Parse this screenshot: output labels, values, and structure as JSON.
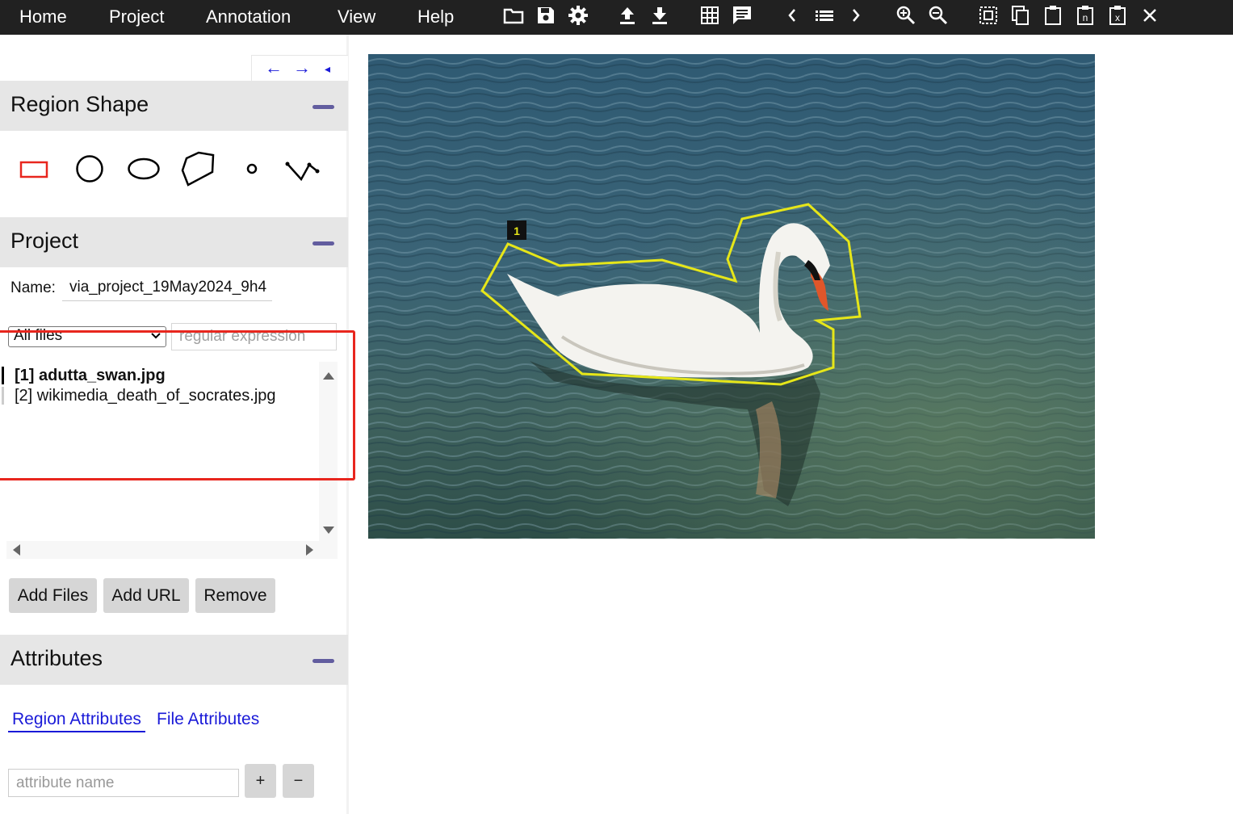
{
  "menu": [
    "Home",
    "Project",
    "Annotation",
    "View",
    "Help"
  ],
  "toolbar_icons": [
    "folder-open-icon",
    "save-icon",
    "settings-gear-icon",
    "upload-icon",
    "download-icon",
    "grid-view-icon",
    "comment-icon",
    "prev-icon",
    "list-icon",
    "next-icon",
    "zoom-in-icon",
    "zoom-out-icon",
    "select-all-icon",
    "copy-icon",
    "paste-icon",
    "paste-n-icon",
    "paste-x-icon",
    "close-icon"
  ],
  "nav_arrows": [
    "←",
    "→",
    "◂"
  ],
  "region_shape": {
    "title": "Region Shape",
    "shapes": [
      "rectangle-icon",
      "circle-icon",
      "ellipse-icon",
      "polygon-icon",
      "point-icon",
      "polyline-icon"
    ]
  },
  "project": {
    "title": "Project",
    "name_label": "Name:",
    "name_value": "via_project_19May2024_9h4",
    "filter_selected": "All files",
    "regex_placeholder": "regular expression",
    "files": [
      "[1] adutta_swan.jpg",
      "[2] wikimedia_death_of_socrates.jpg"
    ],
    "active_file_index": 0,
    "buttons": [
      "Add Files",
      "Add URL",
      "Remove"
    ]
  },
  "attributes": {
    "title": "Attributes",
    "tabs": [
      "Region Attributes",
      "File Attributes"
    ],
    "name_placeholder": "attribute name",
    "add_label": "+",
    "remove_label": "−"
  },
  "canvas": {
    "region_label": "1",
    "region_color": "#e6e619"
  },
  "colors": {
    "toolbar_bg": "#212121",
    "section_bg": "#e6e6e6",
    "collapse_accent": "#625d9f",
    "link_blue": "#1a1ad8",
    "highlight_red": "#e8261e"
  }
}
